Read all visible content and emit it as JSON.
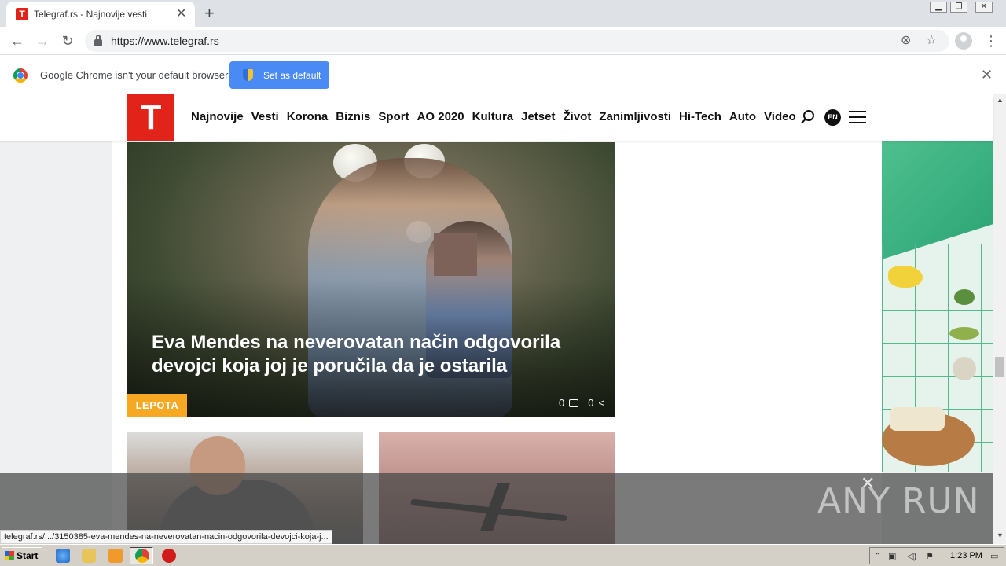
{
  "browser": {
    "tab_title": "Telegraf.rs - Najnovije vesti",
    "tab_favicon": "T",
    "url": "https://www.telegraf.rs",
    "infobar_text": "Google Chrome isn't your default browser",
    "infobar_button": "Set as default",
    "status_link": "telegraf.rs/.../3150385-eva-mendes-na-neverovatan-nacin-odgovorila-devojci-koja-j..."
  },
  "site": {
    "logo": "T",
    "nav": [
      "Najnovije",
      "Vesti",
      "Korona",
      "Biznis",
      "Sport",
      "AO 2020",
      "Kultura",
      "Jetset",
      "Život",
      "Zanimljivosti",
      "Hi-Tech",
      "Auto",
      "Video"
    ],
    "lang": "EN",
    "brand_color": "#e2231a"
  },
  "hero": {
    "title": "Eva Mendes na neverovatan način odgovorila devojci koja joj je poručila da je ostarila",
    "category": "LEPOTA",
    "comments": "0",
    "shares": "0",
    "category_color": "#f7a823"
  },
  "watermark": "ANY RUN",
  "taskbar": {
    "start_label": "Start",
    "clock": "1:23 PM"
  }
}
